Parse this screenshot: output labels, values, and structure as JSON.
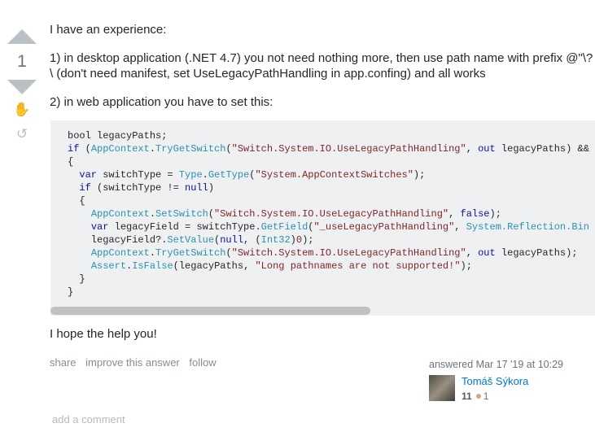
{
  "vote": {
    "count": "1",
    "up_icon": "arrow-up",
    "down_icon": "arrow-down",
    "bookmark_icon": "hand-wave",
    "history_icon": "history"
  },
  "post": {
    "paragraphs": [
      "I have an experience:",
      "1) in desktop application (.NET 4.7) you not need nothing more, then use path name with prefix @\"\\?\\ (don't need manifest, set UseLegacyPathHandling in app.confing) and all works",
      "2) in web application you have to set this:"
    ],
    "code_lines": [
      [
        [
          "",
          "bool legacyPaths;"
        ]
      ],
      [
        [
          "kw",
          "if"
        ],
        [
          "",
          " ("
        ],
        [
          "ty",
          "AppContext"
        ],
        [
          "",
          "."
        ],
        [
          "ty",
          "TryGetSwitch"
        ],
        [
          "",
          "("
        ],
        [
          "st",
          "\"Switch.System.IO.UseLegacyPathHandling\""
        ],
        [
          "",
          ", "
        ],
        [
          "kw",
          "out"
        ],
        [
          "",
          " legacyPaths) &&"
        ]
      ],
      [
        [
          "",
          "{"
        ]
      ],
      [
        [
          "",
          "  "
        ],
        [
          "kw",
          "var"
        ],
        [
          "",
          " switchType = "
        ],
        [
          "ty",
          "Type"
        ],
        [
          "",
          "."
        ],
        [
          "ty",
          "GetType"
        ],
        [
          "",
          "("
        ],
        [
          "st",
          "\"System.AppContextSwitches\""
        ],
        [
          "",
          ");"
        ]
      ],
      [
        [
          "",
          "  "
        ],
        [
          "kw",
          "if"
        ],
        [
          "",
          " (switchType != "
        ],
        [
          "kw",
          "null"
        ],
        [
          "",
          ")"
        ]
      ],
      [
        [
          "",
          "  {"
        ]
      ],
      [
        [
          "",
          "    "
        ],
        [
          "ty",
          "AppContext"
        ],
        [
          "",
          "."
        ],
        [
          "ty",
          "SetSwitch"
        ],
        [
          "",
          "("
        ],
        [
          "st",
          "\"Switch.System.IO.UseLegacyPathHandling\""
        ],
        [
          "",
          ", "
        ],
        [
          "kw",
          "false"
        ],
        [
          "",
          ");"
        ]
      ],
      [
        [
          "",
          "    "
        ],
        [
          "kw",
          "var"
        ],
        [
          "",
          " legacyField = switchType."
        ],
        [
          "ty",
          "GetField"
        ],
        [
          "",
          "("
        ],
        [
          "st",
          "\"_useLegacyPathHandling\""
        ],
        [
          "",
          ", "
        ],
        [
          "ty",
          "System.Reflection.Bin"
        ]
      ],
      [
        [
          "",
          "    legacyField?."
        ],
        [
          "ty",
          "SetValue"
        ],
        [
          "",
          "("
        ],
        [
          "kw",
          "null"
        ],
        [
          "",
          ", ("
        ],
        [
          "ty",
          "Int32"
        ],
        [
          "",
          ")"
        ],
        [
          "lt",
          "0"
        ],
        [
          "",
          ");"
        ]
      ],
      [
        [
          "",
          "    "
        ],
        [
          "ty",
          "AppContext"
        ],
        [
          "",
          "."
        ],
        [
          "ty",
          "TryGetSwitch"
        ],
        [
          "",
          "("
        ],
        [
          "st",
          "\"Switch.System.IO.UseLegacyPathHandling\""
        ],
        [
          "",
          ", "
        ],
        [
          "kw",
          "out"
        ],
        [
          "",
          " legacyPaths);"
        ]
      ],
      [
        [
          "",
          "    "
        ],
        [
          "ty",
          "Assert"
        ],
        [
          "",
          "."
        ],
        [
          "ty",
          "IsFalse"
        ],
        [
          "",
          "(legacyPaths, "
        ],
        [
          "st",
          "\"Long pathnames are not supported!\""
        ],
        [
          "",
          ");"
        ]
      ],
      [
        [
          "",
          "  }"
        ]
      ],
      [
        [
          "",
          "}"
        ]
      ]
    ],
    "closing": "I hope the help you!"
  },
  "menu": {
    "share": "share",
    "improve": "improve this answer",
    "follow": "follow"
  },
  "signature": {
    "answered": "answered Mar 17 '19 at 10:29",
    "user": "Tomáš Sýkora",
    "reputation": "11",
    "bronze": "1",
    "bronze_color": "#d1a684"
  },
  "add_comment": "add a comment",
  "colors": {
    "keyword": "#101094",
    "type": "#2b91af",
    "string": "#7d2727",
    "link": "#0077cc"
  }
}
